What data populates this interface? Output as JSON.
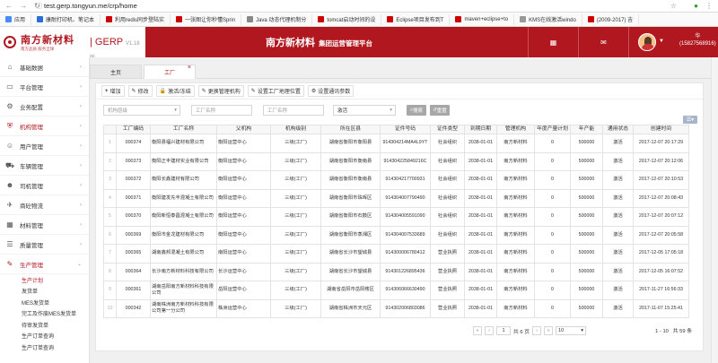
{
  "browser": {
    "url": "test.gerp.tongyun.me/crp/home"
  },
  "bookmarks": [
    {
      "label": "应用",
      "color": "#4a8af4"
    },
    {
      "label": "康耐打印机、笔记本",
      "color": "#2b6cd6"
    },
    {
      "label": "利用redis同步登陆实",
      "color": "#c00"
    },
    {
      "label": "一张图让你秒懂Sprin",
      "color": "#c00"
    },
    {
      "label": "Java 动态代理机制分",
      "color": "#888"
    },
    {
      "label": "tomcat启动时间的设",
      "color": "#c00"
    },
    {
      "label": "Eclipse项目发布到T",
      "color": "#c00"
    },
    {
      "label": "maven+eclipse+to",
      "color": "#c00"
    },
    {
      "label": "KMS在线激活windo",
      "color": "#999"
    },
    {
      "label": "(2009-2017) 吉",
      "color": "#c00"
    }
  ],
  "brand": {
    "name": "南方新材料",
    "slogan": "南方品质 服务全球",
    "product": "GERP",
    "version": "V1.18版"
  },
  "header": {
    "title": "南方新材料",
    "subtitle": "集团运营管理平台",
    "user_name": "华",
    "user_phone": "(15827568916)"
  },
  "sidebar": {
    "items": [
      {
        "label": "基础数据",
        "icon": "home-icon",
        "glyph": "⌂"
      },
      {
        "label": "平台管理",
        "icon": "desktop-icon",
        "glyph": "▭"
      },
      {
        "label": "业务配置",
        "icon": "gear-icon",
        "glyph": "⚙"
      },
      {
        "label": "机构管理",
        "icon": "org-icon",
        "glyph": "⛨",
        "active": true
      },
      {
        "label": "用户管理",
        "icon": "users-icon",
        "glyph": "☺"
      },
      {
        "label": "车辆管理",
        "icon": "truck-icon",
        "glyph": "⛟"
      },
      {
        "label": "司机管理",
        "icon": "driver-icon",
        "glyph": "☻"
      },
      {
        "label": "商砼物流",
        "icon": "plane-icon",
        "glyph": "✈"
      },
      {
        "label": "材料管理",
        "icon": "box-icon",
        "glyph": "▦"
      },
      {
        "label": "质量管理",
        "icon": "quality-icon",
        "glyph": "☰"
      },
      {
        "label": "生产管理",
        "icon": "wrench-icon",
        "glyph": "✎",
        "active": true
      }
    ],
    "subitems": [
      "生产计划",
      "发货单",
      "MES发货单",
      "完工及作废MES发货单",
      "待审发货单",
      "生产订单查询",
      "生产订单查询"
    ]
  },
  "tabs": [
    {
      "label": "主页"
    },
    {
      "label": "工厂",
      "active": true
    }
  ],
  "toolbar": [
    "增加",
    "修改",
    "激活/冻结",
    "更换管理机构",
    "设置工厂地理位置",
    "设置通讯参数"
  ],
  "filters": {
    "placeholders": [
      "机构层级",
      "工厂名称",
      "工厂名称"
    ],
    "status": "激活",
    "search": "搜索",
    "reset": "重置"
  },
  "table": {
    "headers": [
      "",
      "工厂编码",
      "工厂名称",
      "父机构",
      "机构级别",
      "所在区县",
      "证件号码",
      "证件类型",
      "到期日期",
      "管理机构",
      "年度产量计划",
      "年产能",
      "通用状态",
      "创建时间"
    ],
    "rows": [
      [
        "1",
        "000374",
        "衡阳县福兴建材有限公司",
        "衡阳运营中心",
        "三级(工厂)",
        "湖南省衡阳市衡阳县",
        "914304214MA4L9YT",
        "社会组织",
        "2038-01-01",
        "南方新材料",
        "0",
        "500000",
        "激活",
        "2017-12-07 20:17:29"
      ],
      [
        "2",
        "000373",
        "衡阳正丰建材实业有限公司",
        "衡阳运营中心",
        "三级(工厂)",
        "湖南省衡阳市衡南县",
        "914304225849216C",
        "社会组织",
        "2038-01-01",
        "南方新材料",
        "0",
        "500000",
        "激活",
        "2017-12-07 20:12:06"
      ],
      [
        "3",
        "000372",
        "衡阳长鑫建材有限公司",
        "衡阳运营中心",
        "三级(工厂)",
        "湖南省衡阳市衡南县",
        "914304217700931",
        "社会组织",
        "2038-01-01",
        "南方新材料",
        "0",
        "500000",
        "激活",
        "2017-12-07 20:10:53"
      ],
      [
        "4",
        "000371",
        "衡阳建发先丰混凝土有限公司",
        "衡阳运营中心",
        "三级(工厂)",
        "湖南省衡阳市珠晖区",
        "914304007790490",
        "社会组织",
        "2038-01-01",
        "南方新材料",
        "0",
        "500000",
        "激活",
        "2017-12-07 20:08:43"
      ],
      [
        "5",
        "000370",
        "衡阳新恒泰昌混凝土有限公司",
        "衡阳运营中心",
        "三级(工厂)",
        "湖南省衡阳市石鼓区",
        "914304005591090",
        "社会组织",
        "2038-01-01",
        "南方新材料",
        "0",
        "500000",
        "激活",
        "2017-12-07 20:07:12"
      ],
      [
        "6",
        "000369",
        "衡阳市金龙建材有限公司",
        "衡阳运营中心",
        "三级(工厂)",
        "湖南省衡阳市蒸湘区",
        "914304007533689",
        "社会组织",
        "2038-01-01",
        "南方新材料",
        "0",
        "500000",
        "激活",
        "2017-12-07 20:05:58"
      ],
      [
        "7",
        "000365",
        "湖南鑫邦混凝土有限公司",
        "南阳运营中心",
        "三级(工厂)",
        "湖南省长沙市望城县",
        "914300006780412",
        "营业执照",
        "2038-01-01",
        "南方新材料",
        "0",
        "500000",
        "激活",
        "2017-12-05 17:05:18"
      ],
      [
        "8",
        "000364",
        "长沙南方新材料科技有限公司",
        "长沙运营中心",
        "三级(工厂)",
        "湖南省长沙市望城县",
        "914301226895436",
        "营业执照",
        "2038-01-01",
        "南方新材料",
        "0",
        "500000",
        "激活",
        "2017-12-05 16:07:52"
      ],
      [
        "9",
        "000361",
        "湖南岳阳南方新材料科技有限公司",
        "岳阳运营中心",
        "三级(工厂)",
        "湖南省岳阳市岳阳楼区",
        "914306066630490",
        "营业执照",
        "2038-01-01",
        "南方新材料",
        "0",
        "500000",
        "激活",
        "2017-11-27 16:56:33"
      ],
      [
        "10",
        "000342",
        "湖南株洲南方新材料科技有限公司第一分公司",
        "株洲运营中心",
        "三级(工厂)",
        "湖南省株洲市天元区",
        "914302006803086",
        "营业执照",
        "2038-01-01",
        "南方新材料",
        "0",
        "500000",
        "激活",
        "2017-11-07 15:25:41"
      ]
    ]
  },
  "pager": {
    "page": "1",
    "total_pages": "共 6 页",
    "page_size": "10",
    "range": "1 - 10",
    "total": "共 59 条"
  }
}
